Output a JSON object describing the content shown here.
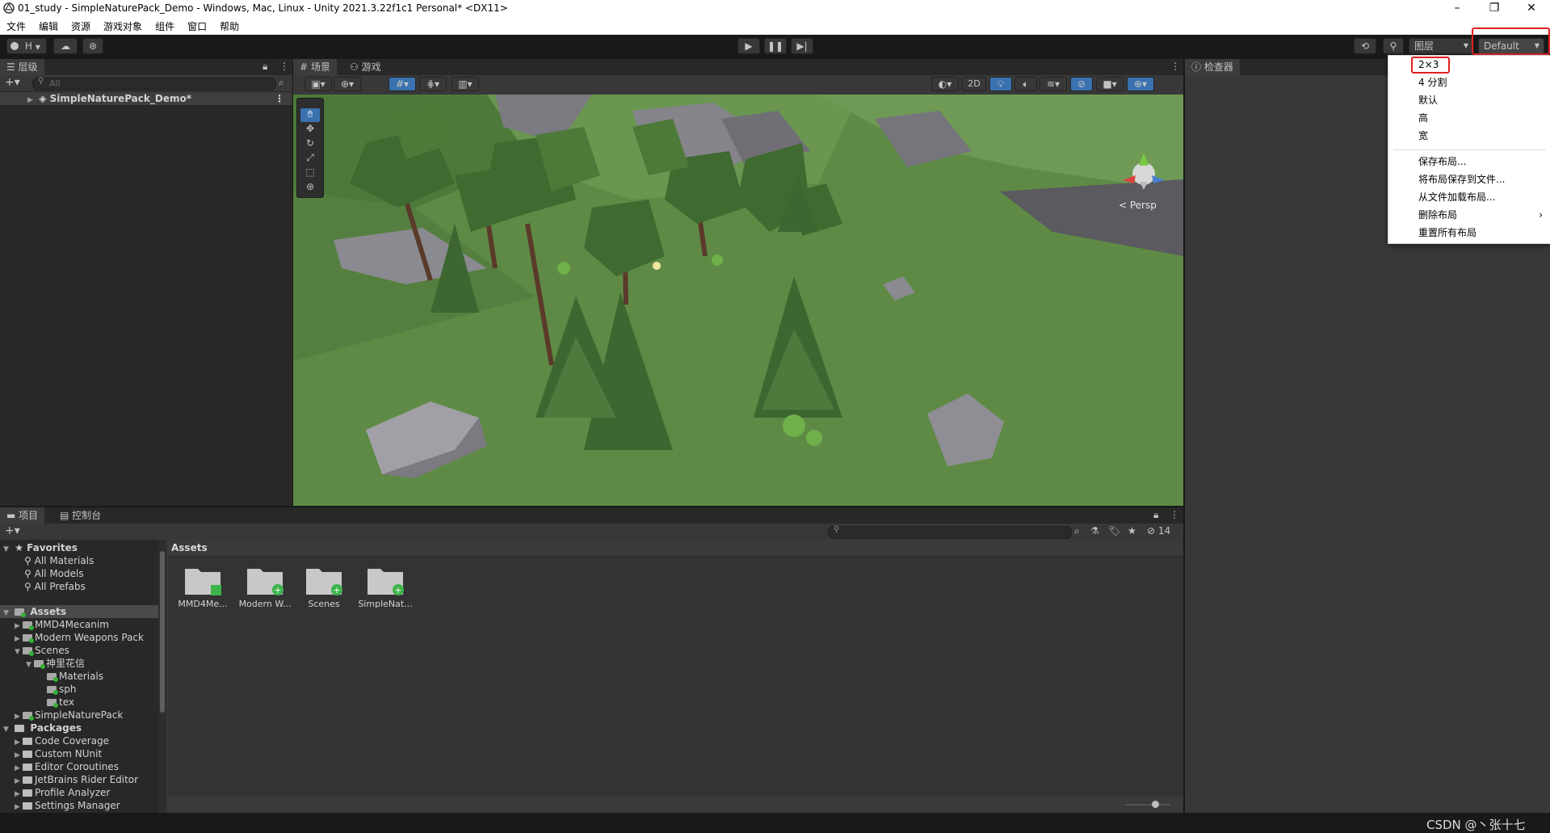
{
  "window": {
    "title": "01_study - SimpleNaturePack_Demo - Windows, Mac, Linux - Unity 2021.3.22f1c1 Personal* <DX11>"
  },
  "menubar": [
    "文件",
    "编辑",
    "资源",
    "游戏对象",
    "组件",
    "窗口",
    "帮助"
  ],
  "toolbar": {
    "account_label": "H",
    "layers_label": "图层",
    "layout_label": "Default"
  },
  "hierarchy": {
    "tab": "层级",
    "search_placeholder": "All",
    "scene_name": "SimpleNaturePack_Demo*"
  },
  "scene": {
    "tab_scene": "场景",
    "tab_game": "游戏",
    "mode_2d": "2D",
    "persp_label": "< Persp"
  },
  "inspector": {
    "tab": "检查器"
  },
  "layout_menu": {
    "items": [
      "2×3",
      "4 分割",
      "默认",
      "高",
      "宽"
    ],
    "actions": [
      "保存布局...",
      "将布局保存到文件...",
      "从文件加载布局...",
      "删除布局",
      "重置所有布局"
    ],
    "submenu_arrow": "›"
  },
  "project": {
    "tab_project": "项目",
    "tab_console": "控制台",
    "hidden_count": "14",
    "breadcrumb": "Assets",
    "favorites": {
      "label": "Favorites",
      "items": [
        "All Materials",
        "All Models",
        "All Prefabs"
      ]
    },
    "assets_tree": {
      "label": "Assets",
      "items": [
        "MMD4Mecanim",
        "Modern Weapons Pack",
        "Scenes",
        "神里花信",
        "Materials",
        "sph",
        "tex",
        "SimpleNaturePack"
      ]
    },
    "packages_tree": {
      "label": "Packages",
      "items": [
        "Code Coverage",
        "Custom NUnit",
        "Editor Coroutines",
        "JetBrains Rider Editor",
        "Profile Analyzer",
        "Settings Manager"
      ]
    },
    "asset_grid": [
      "MMD4Me...",
      "Modern W...",
      "Scenes",
      "SimpleNat..."
    ]
  },
  "watermark": "CSDN @丶张十七",
  "colors": {
    "highlight_red": "#e02020",
    "selected_tool": "#3a72b0",
    "grass": "#5f8a45"
  }
}
